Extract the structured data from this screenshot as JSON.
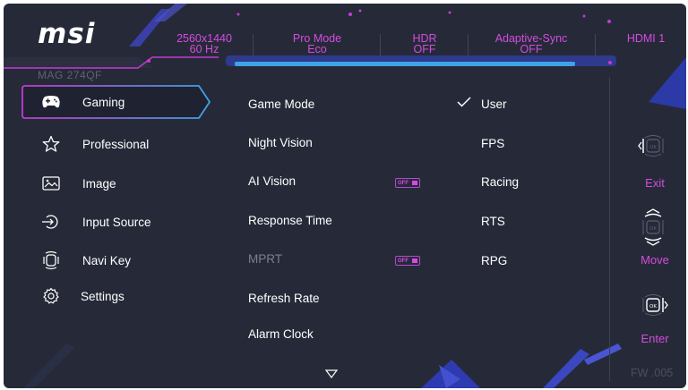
{
  "brand": {
    "logo": "msi"
  },
  "model": "MAG 274QF",
  "status": [
    {
      "line1": "2560x1440",
      "line2": "60 Hz"
    },
    {
      "line1": "Pro Mode",
      "line2": "Eco"
    },
    {
      "line1": "HDR",
      "line2": "OFF"
    },
    {
      "line1": "Adaptive-Sync",
      "line2": "OFF"
    },
    {
      "line1": "HDMI 1",
      "line2": ""
    }
  ],
  "menu": [
    {
      "label": "Gaming",
      "icon": "gamepad-icon",
      "active": true
    },
    {
      "label": "Professional",
      "icon": "star-icon",
      "active": false
    },
    {
      "label": "Image",
      "icon": "image-icon",
      "active": false
    },
    {
      "label": "Input Source",
      "icon": "input-source-icon",
      "active": false
    },
    {
      "label": "Navi Key",
      "icon": "navi-key-icon",
      "active": false
    },
    {
      "label": "Settings",
      "icon": "gear-icon",
      "active": false
    }
  ],
  "submenu": [
    {
      "label": "Game Mode"
    },
    {
      "label": "Night Vision"
    },
    {
      "label": "AI Vision",
      "toggle": "OFF"
    },
    {
      "label": "Response Time"
    },
    {
      "label": "MPRT",
      "toggle": "OFF",
      "disabled": true
    },
    {
      "label": "Refresh Rate"
    },
    {
      "label": "Alarm Clock"
    }
  ],
  "options": [
    {
      "label": "User",
      "selected": true
    },
    {
      "label": "FPS"
    },
    {
      "label": "Racing"
    },
    {
      "label": "RTS"
    },
    {
      "label": "RPG"
    }
  ],
  "keys": [
    {
      "label": "Exit",
      "icon": "exit-key-icon"
    },
    {
      "label": "Move",
      "icon": "move-key-icon"
    },
    {
      "label": "Enter",
      "icon": "enter-key-icon",
      "ok": "OK"
    }
  ],
  "firmware": "FW .005",
  "colors": {
    "background": "#262a38",
    "accent": "#d44be0",
    "highlight": "#3fa3e8"
  }
}
